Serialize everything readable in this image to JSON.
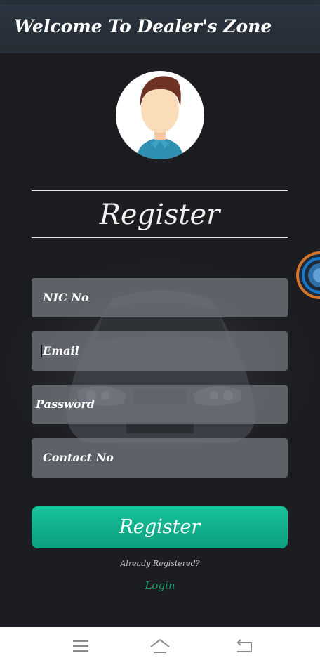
{
  "app_bar": {
    "title": "Welcome To Dealer's Zone"
  },
  "register_form": {
    "heading": "Register",
    "fields": [
      {
        "placeholder": "NIC No"
      },
      {
        "placeholder": "Email"
      },
      {
        "placeholder": "Password"
      },
      {
        "placeholder": "Contact No"
      }
    ],
    "submit_label": "Register",
    "already_registered": "Already Registered?",
    "login_label": "Login"
  },
  "colors": {
    "app_bar": "#2b3540",
    "background": "#1b1d20",
    "button": "#12b08c",
    "login_link": "#14a56e",
    "field": "#70747c"
  },
  "icons": {
    "avatar": "user-avatar-icon",
    "floating": "floating-assistant-icon",
    "nav_menu": "menu-icon",
    "nav_home": "home-icon",
    "nav_back": "back-icon"
  }
}
